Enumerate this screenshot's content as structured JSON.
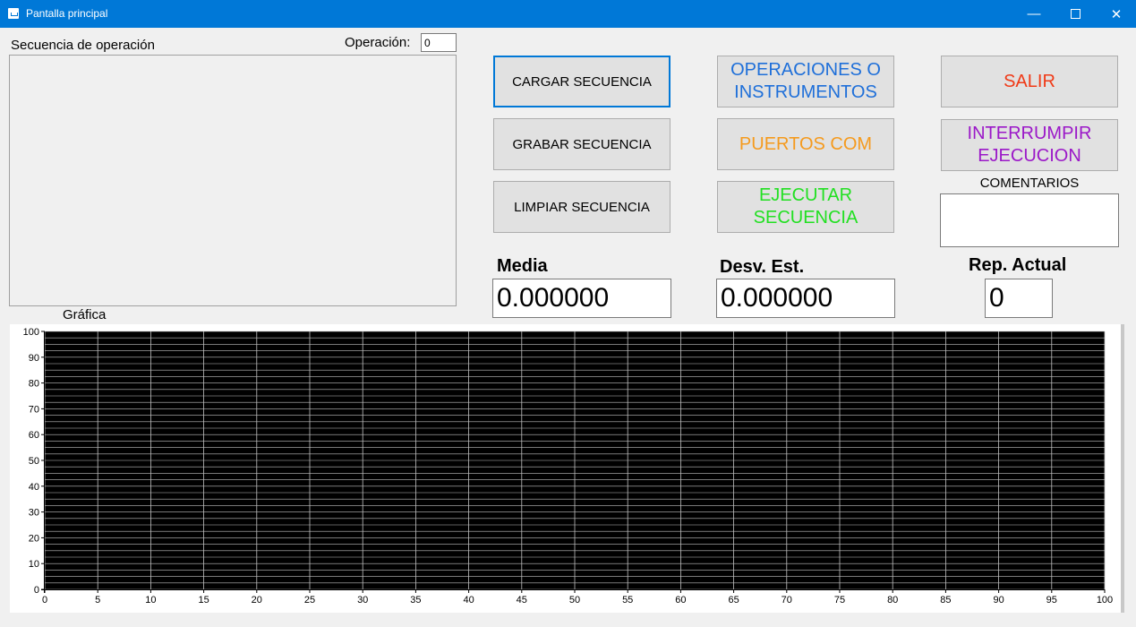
{
  "window": {
    "title": "Pantalla principal",
    "icon": "form-icon",
    "controls": [
      "minimize-icon",
      "maximize-icon",
      "close-icon"
    ]
  },
  "sequence": {
    "label": "Secuencia de operación",
    "operation_label": "Operación:",
    "operation_value": "0"
  },
  "buttons": {
    "cargar": "CARGAR SECUENCIA",
    "grabar": "GRABAR SECUENCIA",
    "limpiar": "LIMPIAR SECUENCIA",
    "operaciones_line1": "OPERACIONES O",
    "operaciones_line2": "INSTRUMENTOS",
    "puertos": "PUERTOS COM",
    "ejecutar_line1": "EJECUTAR",
    "ejecutar_line2": "SECUENCIA",
    "salir": "SALIR",
    "interrumpir_line1": "INTERRUMPIR",
    "interrumpir_line2": "EJECUCION"
  },
  "colors": {
    "operaciones": "#1e6fd9",
    "puertos": "#f59a1d",
    "ejecutar": "#22e022",
    "salir": "#f03a17",
    "interrumpir": "#9b18c8",
    "plot_background": "#000000",
    "grid": "#c0c0c0"
  },
  "comments": {
    "label": "COMENTARIOS",
    "value": ""
  },
  "stats": {
    "media_label": "Media",
    "media_value": "0.000000",
    "desv_label": "Desv. Est.",
    "desv_value": "0.000000",
    "rep_label": "Rep. Actual",
    "rep_value": "0"
  },
  "chart_label": "Gráfica",
  "chart_data": {
    "type": "line",
    "series": [],
    "xlim": [
      0,
      100
    ],
    "ylim": [
      0,
      100
    ],
    "x_ticks": [
      0,
      5,
      10,
      15,
      20,
      25,
      30,
      35,
      40,
      45,
      50,
      55,
      60,
      65,
      70,
      75,
      80,
      85,
      90,
      95,
      100
    ],
    "y_ticks": [
      0,
      10,
      20,
      30,
      40,
      50,
      60,
      70,
      80,
      90,
      100
    ],
    "y_minor_step": 2.5,
    "grid": true
  }
}
